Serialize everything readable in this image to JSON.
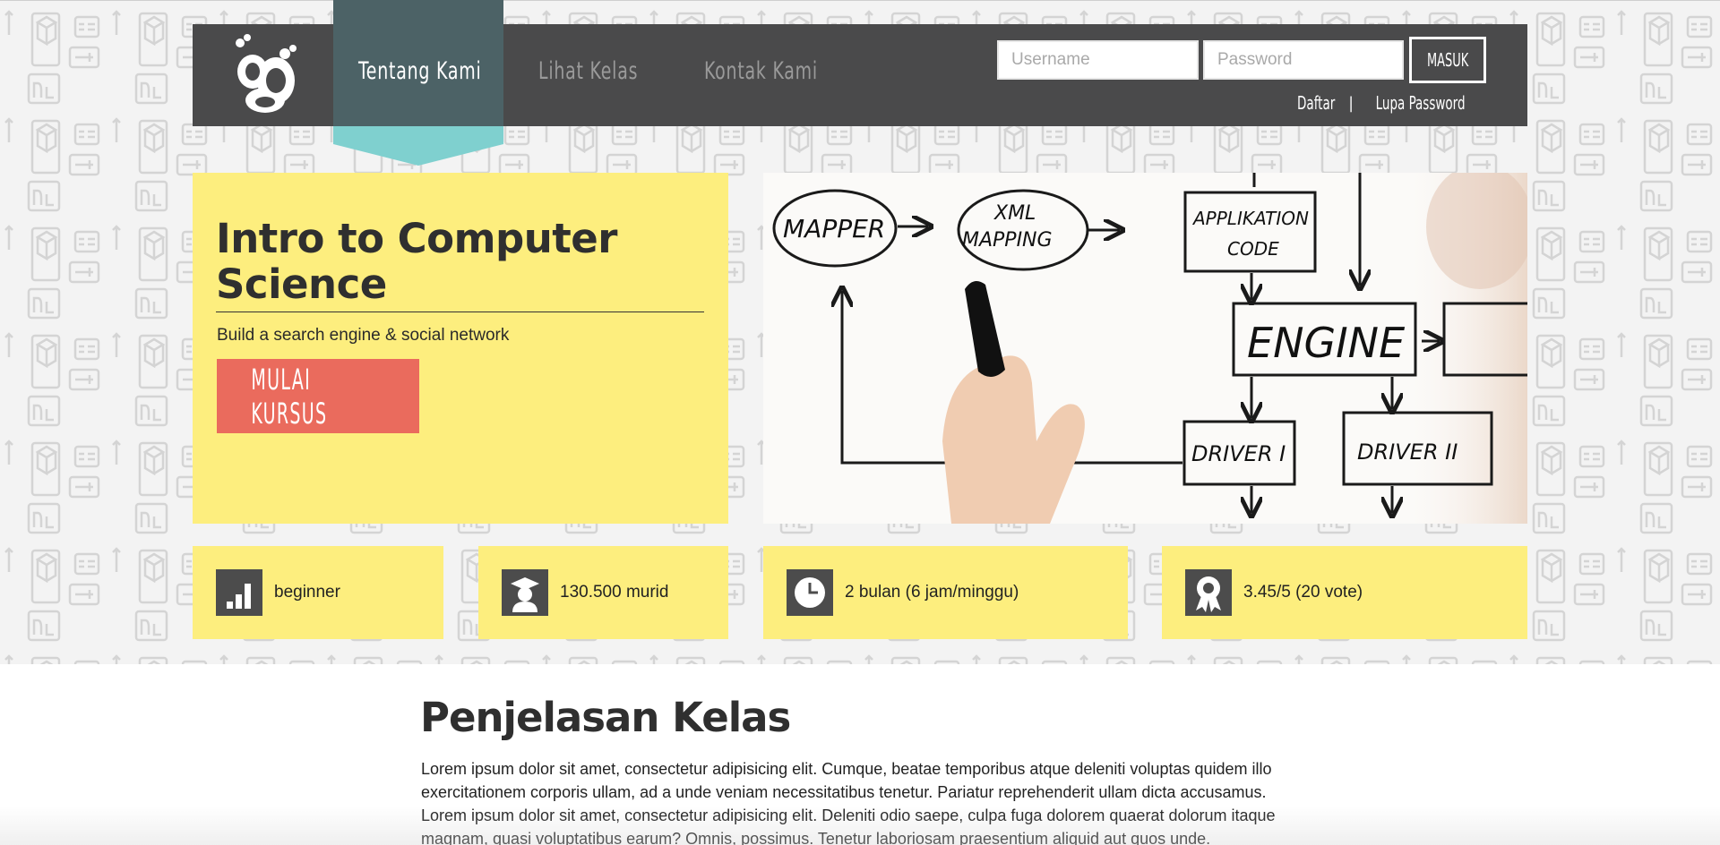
{
  "nav": {
    "items": [
      {
        "label": "Tentang Kami",
        "active": true
      },
      {
        "label": "Lihat Kelas",
        "active": false
      },
      {
        "label": "Kontak Kami",
        "active": false
      }
    ]
  },
  "login": {
    "username_placeholder": "Username",
    "password_placeholder": "Password",
    "submit_label": "MASUK",
    "register_label": "Daftar",
    "separator": "|",
    "forgot_label": "Lupa Password"
  },
  "hero": {
    "title": "Intro to Computer Science",
    "subtitle": "Build a search engine & social network",
    "cta_label": "MULAI KURSUS",
    "image_labels": {
      "mapper": "MAPPER",
      "xml_mapping_1": "XML",
      "xml_mapping_2": "MAPPING",
      "app_code_1": "APPLIKATION",
      "app_code_2": "CODE",
      "engine": "ENGINE",
      "driver1": "DRIVER I",
      "driver2": "DRIVER II"
    }
  },
  "stats": [
    {
      "icon": "bar-chart-icon",
      "text": "beginner"
    },
    {
      "icon": "graduate-icon",
      "text": "130.500 murid"
    },
    {
      "icon": "clock-icon",
      "text": "2 bulan (6 jam/minggu)"
    },
    {
      "icon": "award-ribbon-icon",
      "text": "3.45/5 (20 vote)"
    }
  ],
  "content": {
    "title": "Penjelasan Kelas",
    "body": "Lorem ipsum dolor sit amet, consectetur adipisicing elit. Cumque, beatae temporibus atque deleniti voluptas quidem illo exercitationem corporis ullam, ad a unde veniam necessitatibus tenetur. Pariatur reprehenderit ullam dicta accusamus. Lorem ipsum dolor sit amet, consectetur adipisicing elit. Deleniti odio saepe, culpa fuga dolorem quaerat dolorum itaque magnam, quasi voluptatibus earum? Omnis, possimus. Tenetur laboriosam praesentium aliquid aut quos unde."
  },
  "colors": {
    "nav_bg": "#4a4a4b",
    "nav_active_bg": "#4c6266",
    "ribbon": "#7fd0cf",
    "card_yellow": "#fdee7e",
    "cta_red": "#ea6b5d"
  }
}
